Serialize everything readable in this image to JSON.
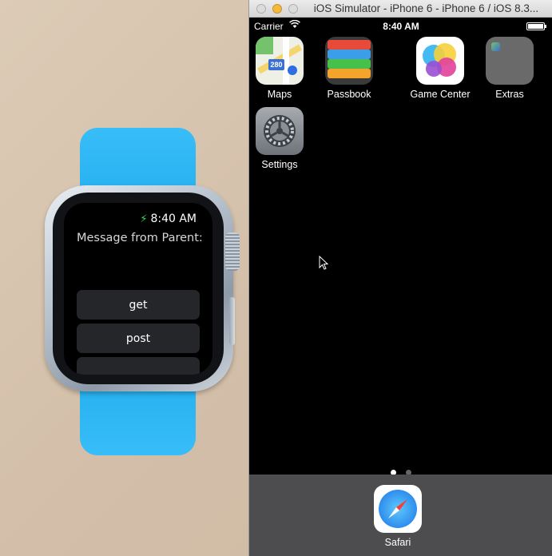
{
  "simulator": {
    "window_title": "iOS Simulator - iPhone 6 - iPhone 6 / iOS 8.3...",
    "status_bar": {
      "carrier": "Carrier",
      "time": "8:40 AM"
    },
    "apps": [
      {
        "label": "Maps",
        "icon": "maps-icon"
      },
      {
        "label": "Passbook",
        "icon": "passbook-icon"
      },
      {
        "label": "Game Center",
        "icon": "game-center-icon"
      },
      {
        "label": "Extras",
        "icon": "folder-icon"
      },
      {
        "label": "Settings",
        "icon": "settings-icon"
      }
    ],
    "page_dots": {
      "count": 2,
      "active_index": 0
    },
    "dock": [
      {
        "label": "Safari",
        "icon": "safari-icon"
      }
    ],
    "maps_route_badge": "280"
  },
  "watch": {
    "time": "8:40 AM",
    "message_label": "Message from Parent:",
    "buttons": [
      "get",
      "post",
      ""
    ],
    "band_color": "#2fb6f4",
    "charging_color": "#2ee25b"
  }
}
